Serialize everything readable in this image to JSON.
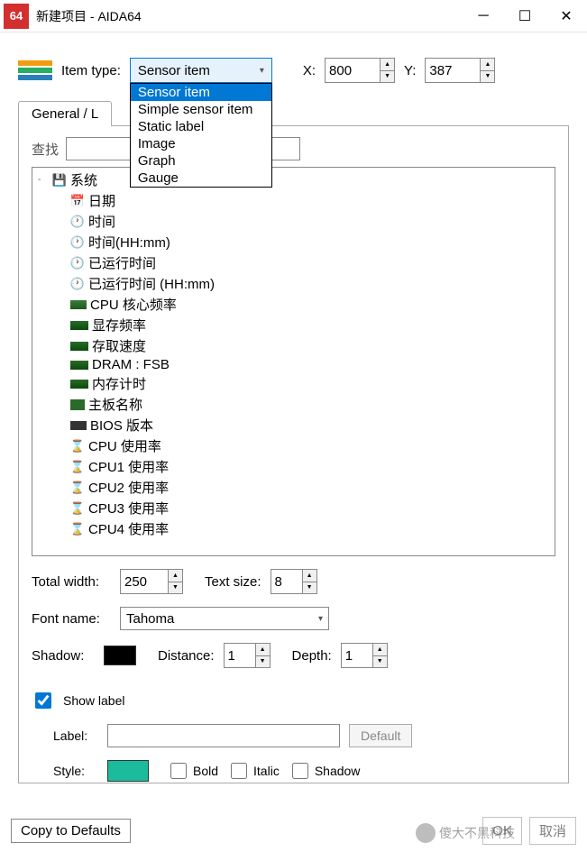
{
  "titlebar": {
    "app_badge": "64",
    "title": "新建项目 - AIDA64"
  },
  "row1": {
    "item_type_label": "Item type:",
    "item_type_value": "Sensor item",
    "dropdown_items": [
      "Sensor item",
      "Simple sensor item",
      "Static label",
      "Image",
      "Graph",
      "Gauge"
    ],
    "x_label": "X:",
    "x_value": "800",
    "y_label": "Y:",
    "y_value": "387"
  },
  "tabs": {
    "tab1": "General / L"
  },
  "find": {
    "label": "查找",
    "value": ""
  },
  "tree": [
    {
      "icon": "drive",
      "label": "系统",
      "lvl": 0,
      "exp": "-"
    },
    {
      "icon": "cal",
      "label": "日期",
      "lvl": 1
    },
    {
      "icon": "clock",
      "label": "时间",
      "lvl": 1
    },
    {
      "icon": "clock",
      "label": "时间(HH:mm)",
      "lvl": 1
    },
    {
      "icon": "clock",
      "label": "已运行时间",
      "lvl": 1
    },
    {
      "icon": "clock",
      "label": "已运行时间 (HH:mm)",
      "lvl": 1
    },
    {
      "icon": "chip",
      "label": "CPU 核心频率",
      "lvl": 1
    },
    {
      "icon": "ram",
      "label": "显存频率",
      "lvl": 1
    },
    {
      "icon": "ram",
      "label": "存取速度",
      "lvl": 1
    },
    {
      "icon": "ram",
      "label": "DRAM : FSB",
      "lvl": 1
    },
    {
      "icon": "ram",
      "label": "内存计时",
      "lvl": 1
    },
    {
      "icon": "mb",
      "label": "主板名称",
      "lvl": 1
    },
    {
      "icon": "bios",
      "label": "BIOS 版本",
      "lvl": 1
    },
    {
      "icon": "hour",
      "label": "CPU 使用率",
      "lvl": 1
    },
    {
      "icon": "hour",
      "label": "CPU1 使用率",
      "lvl": 1
    },
    {
      "icon": "hour",
      "label": "CPU2 使用率",
      "lvl": 1
    },
    {
      "icon": "hour",
      "label": "CPU3 使用率",
      "lvl": 1
    },
    {
      "icon": "hour",
      "label": "CPU4 使用率",
      "lvl": 1
    }
  ],
  "props": {
    "total_width_label": "Total width:",
    "total_width": "250",
    "text_size_label": "Text size:",
    "text_size": "8",
    "font_name_label": "Font name:",
    "font_name": "Tahoma",
    "shadow_label": "Shadow:",
    "shadow_color": "#000000",
    "distance_label": "Distance:",
    "distance": "1",
    "depth_label": "Depth:",
    "depth": "1",
    "show_label": "Show label",
    "label_label": "Label:",
    "label_value": "",
    "default_btn": "Default",
    "style_label": "Style:",
    "style_color": "#1abc9c",
    "bold": "Bold",
    "italic": "Italic",
    "shadow_cb": "Shadow"
  },
  "footer": {
    "copy_defaults": "Copy to Defaults",
    "ok": "OK",
    "cancel": "取消",
    "watermark": "傻大不黑科技"
  }
}
